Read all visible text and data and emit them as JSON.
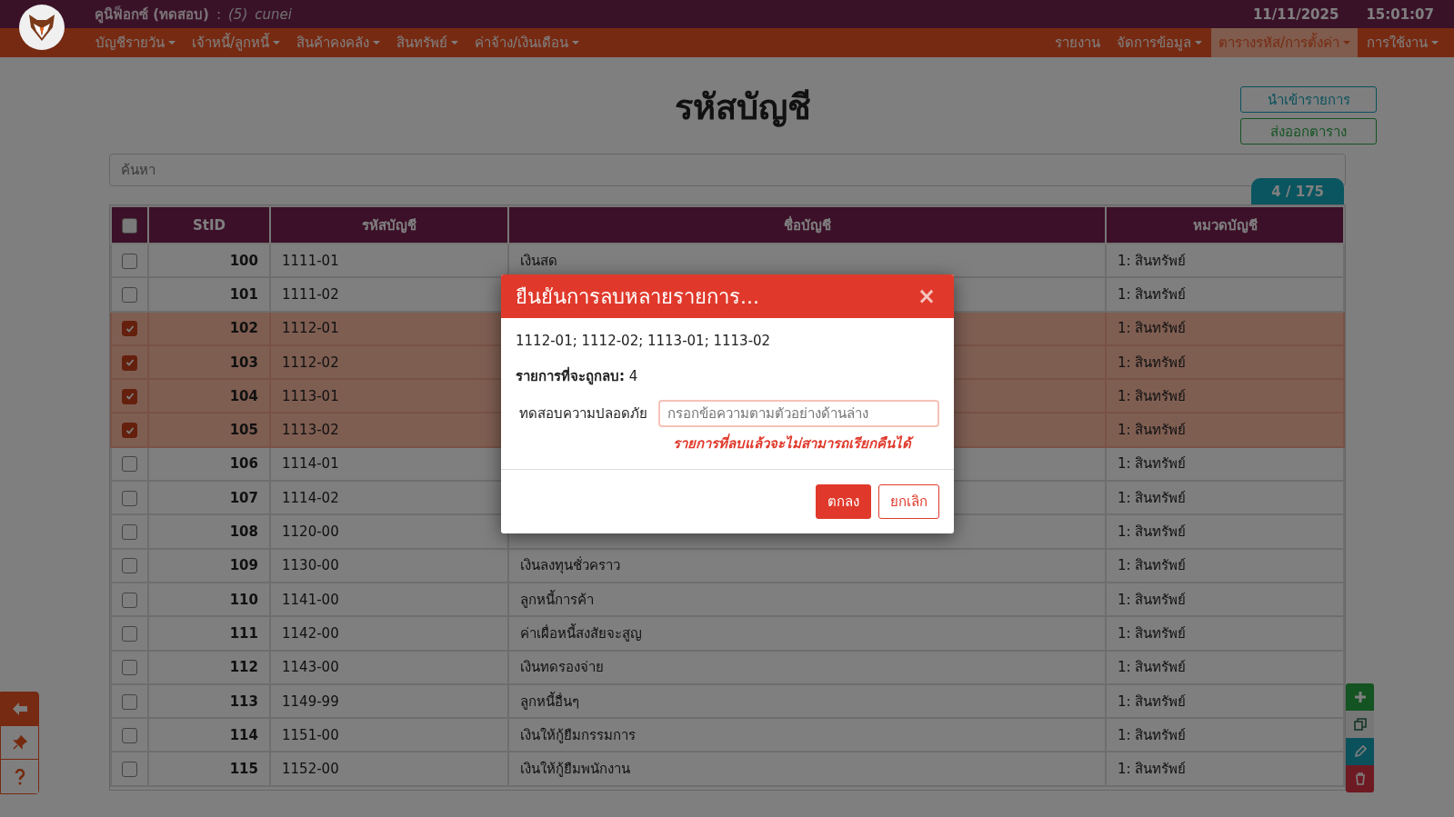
{
  "app": {
    "title": "คูนิฟ็อกซ์ (ทดสอบ)",
    "separator": ":",
    "user_level": "(5)",
    "user": "cunei",
    "date": "11/11/2025",
    "time": "15:01:07"
  },
  "menu_left": [
    {
      "label": "บัญชีรายวัน",
      "dropdown": true
    },
    {
      "label": "เจ้าหนี้/ลูกหนี้",
      "dropdown": true
    },
    {
      "label": "สินค้าคงคลัง",
      "dropdown": true
    },
    {
      "label": "สินทรัพย์",
      "dropdown": true
    },
    {
      "label": "ค่าจ้าง/เงินเดือน",
      "dropdown": true
    }
  ],
  "menu_right": [
    {
      "label": "รายงาน",
      "dropdown": false,
      "selected": false
    },
    {
      "label": "จัดการข้อมูล",
      "dropdown": true,
      "selected": false
    },
    {
      "label": "ตารางรหัส/การตั้งค่า",
      "dropdown": true,
      "selected": true
    },
    {
      "label": "การใช้งาน",
      "dropdown": true,
      "selected": false
    }
  ],
  "page": {
    "title": "รหัสบัญชี",
    "import_button": "นำเข้ารายการ",
    "export_button": "ส่งออกตาราง",
    "search": {
      "placeholder": "ค้นหา"
    },
    "count": "4 / 175"
  },
  "table": {
    "all_checked": false,
    "columns": [
      "StID",
      "รหัสบัญชี",
      "ชื่อบัญชี",
      "หมวดบัญชี"
    ],
    "rows": [
      {
        "id": "100",
        "code": "1111-01",
        "name": "เงินสด",
        "category": "1: สินทรัพย์",
        "checked": false
      },
      {
        "id": "101",
        "code": "1111-02",
        "category": "1: สินทรัพย์",
        "checked": false
      },
      {
        "id": "102",
        "code": "1112-01",
        "category": "1: สินทรัพย์",
        "checked": true
      },
      {
        "id": "103",
        "code": "1112-02",
        "category": "1: สินทรัพย์",
        "checked": true
      },
      {
        "id": "104",
        "code": "1113-01",
        "category": "1: สินทรัพย์",
        "checked": true
      },
      {
        "id": "105",
        "code": "1113-02",
        "category": "1: สินทรัพย์",
        "checked": true
      },
      {
        "id": "106",
        "code": "1114-01",
        "category": "1: สินทรัพย์",
        "checked": false
      },
      {
        "id": "107",
        "code": "1114-02",
        "category": "1: สินทรัพย์",
        "checked": false
      },
      {
        "id": "108",
        "code": "1120-00",
        "category": "1: สินทรัพย์",
        "checked": false
      },
      {
        "id": "109",
        "code": "1130-00",
        "name": "เงินลงทุนชั่วคราว",
        "category": "1: สินทรัพย์",
        "checked": false
      },
      {
        "id": "110",
        "code": "1141-00",
        "name": "ลูกหนี้การค้า",
        "category": "1: สินทรัพย์",
        "checked": false
      },
      {
        "id": "111",
        "code": "1142-00",
        "name": "ค่าเผื่อหนี้สงสัยจะสูญ",
        "category": "1: สินทรัพย์",
        "checked": false
      },
      {
        "id": "112",
        "code": "1143-00",
        "name": "เงินทดรองจ่าย",
        "category": "1: สินทรัพย์",
        "checked": false
      },
      {
        "id": "113",
        "code": "1149-99",
        "name": "ลูกหนี้อื่นๆ",
        "category": "1: สินทรัพย์",
        "checked": false
      },
      {
        "id": "114",
        "code": "1151-00",
        "name": "เงินให้กู้ยืมกรรมการ",
        "category": "1: สินทรัพย์",
        "checked": false
      },
      {
        "id": "115",
        "code": "1152-00",
        "name": "เงินให้กู้ยืมพนักงาน",
        "category": "1: สินทรัพย์",
        "checked": false
      }
    ]
  },
  "modal": {
    "title": "ยืนยันการลบหลายรายการ...",
    "close": "×",
    "codes": "1112-01; 1112-02; 1113-01; 1113-02",
    "count_label": "รายการที่จะถูกลบ:",
    "count": "4",
    "field_label": "ทดสอบความปลอดภัย",
    "placeholder": "กรอกข้อความตามตัวอย่างด้านล่าง",
    "warning": "รายการที่ลบแล้วจะไม่สามารถเรียกคืนได้",
    "ok_button": "ตกลง",
    "cancel_button": "ยกเลิก"
  }
}
